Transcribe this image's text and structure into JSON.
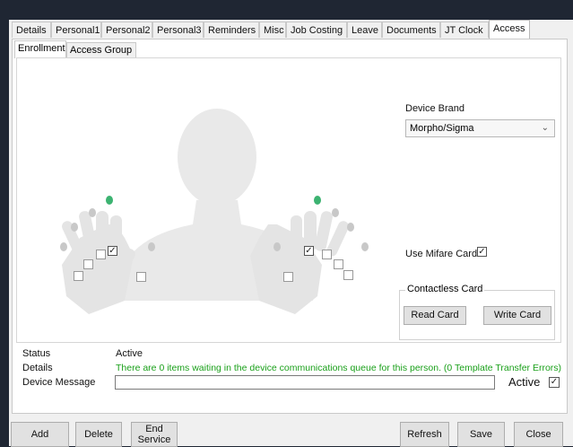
{
  "main_tabs": [
    "Details",
    "Personal1",
    "Personal2",
    "Personal3",
    "Reminders",
    "Misc",
    "Job Costing",
    "Leave",
    "Documents",
    "JT Clock",
    "Access"
  ],
  "active_main_tab": "Access",
  "sub_tabs": [
    "Enrollment",
    "Access Group"
  ],
  "active_sub_tab": "Enrollment",
  "device_brand": {
    "label": "Device Brand",
    "value": "Morpho/Sigma"
  },
  "mifare": {
    "label": "Use Mifare Card",
    "checked": true
  },
  "contactless": {
    "title": "Contactless Card",
    "read_label": "Read Card",
    "write_label": "Write Card"
  },
  "status": {
    "status_label": "Status",
    "status_value": "Active",
    "details_label": "Details",
    "details_value": "There are 0 items waiting in the device communications queue for this person. (0 Template Transfer Errors)",
    "device_message_label": "Device Message",
    "device_message_value": "",
    "active_label": "Active",
    "active_checked": true
  },
  "bottom_buttons": {
    "add": "Add",
    "delete": "Delete",
    "end_service_1": "End",
    "end_service_2": "Service",
    "refresh": "Refresh",
    "save": "Save",
    "close": "Close"
  },
  "colors": {
    "enrolled_finger": "#3cb371",
    "details_text": "#1aa01a",
    "window_bg": "#f0f0f0",
    "frame": "#1f2633"
  },
  "icons": [
    "fingerprint-icon",
    "checkbox-icon",
    "chevron-down-icon"
  ],
  "fingers": {
    "left_hand_checked": [
      false,
      false,
      false,
      true,
      false
    ],
    "right_hand_checked": [
      true,
      false,
      false,
      false,
      false
    ],
    "enrolled": [
      "left-middle",
      "right-middle"
    ]
  }
}
